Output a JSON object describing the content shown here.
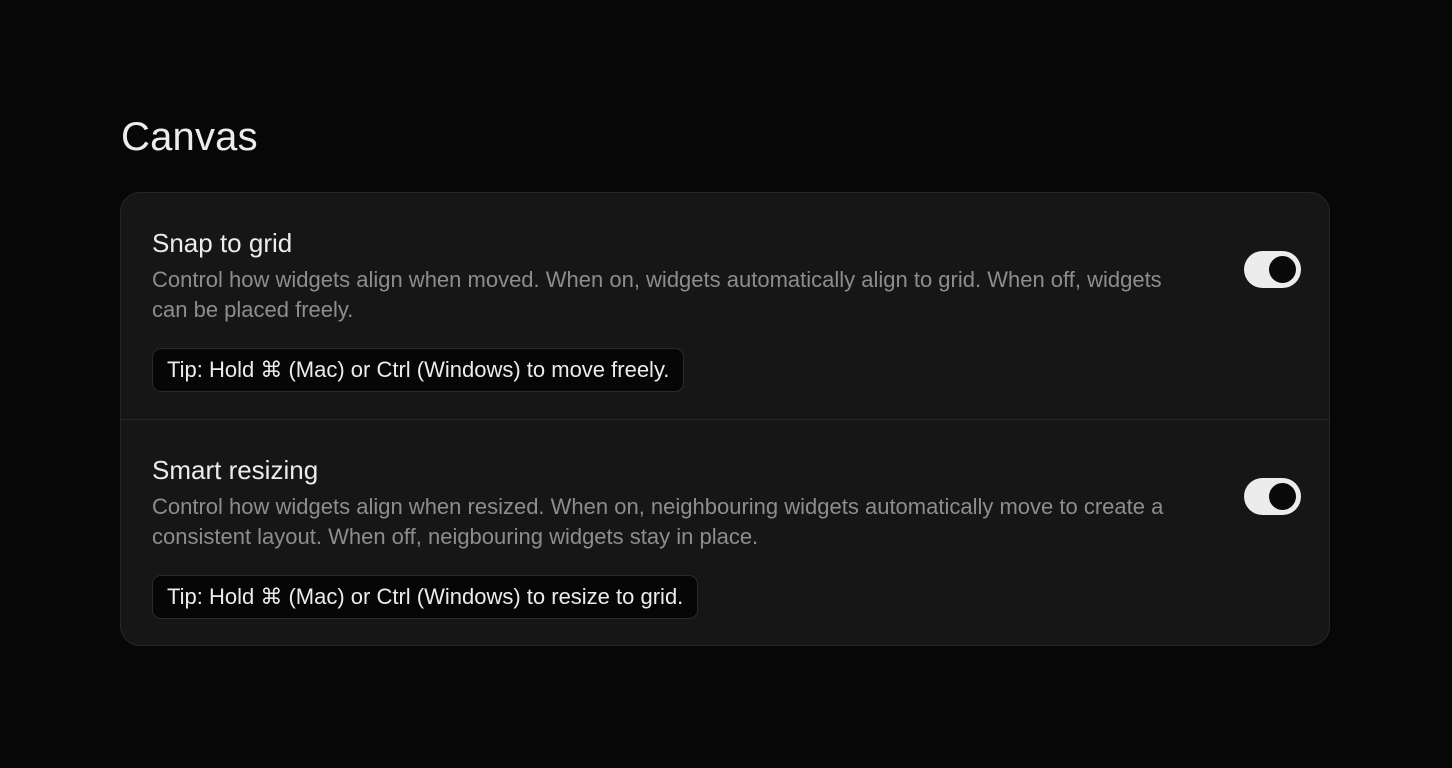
{
  "section": {
    "title": "Canvas"
  },
  "settings": [
    {
      "title": "Snap to grid",
      "description": "Control how widgets align when moved. When on, widgets automatically align to grid. When off, widgets can be placed freely.",
      "tip": "Tip: Hold ⌘ (Mac) or Ctrl (Windows) to move freely.",
      "enabled": true
    },
    {
      "title": "Smart resizing",
      "description": "Control how widgets align when resized. When on, neighbouring widgets automatically move to create a consistent layout. When off, neigbouring widgets stay in place.",
      "tip": "Tip: Hold ⌘ (Mac) or Ctrl (Windows) to resize to grid.",
      "enabled": true
    }
  ],
  "colors": {
    "background": "#070707",
    "card": "#161616",
    "text": "#ececec",
    "muted": "#8d8d8d",
    "toggle_on": "#ececec"
  }
}
